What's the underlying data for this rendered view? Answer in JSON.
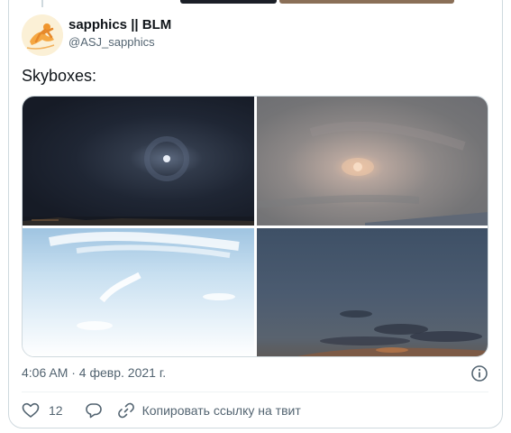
{
  "author": {
    "name": "sapphics || BLM",
    "handle": "@ASJ_sapphics"
  },
  "tweet": {
    "text": "Skyboxes:",
    "timestamp": "4:06 AM · 4 февр. 2021 г."
  },
  "media": [
    {
      "name": "dark-night-sky-moon"
    },
    {
      "name": "overcast-sky-sun"
    },
    {
      "name": "blue-sky-clouds"
    },
    {
      "name": "dusk-sky-clouds"
    }
  ],
  "actions": {
    "like_icon": "heart-icon",
    "like_count": "12",
    "reply_icon": "reply-icon",
    "copy_icon": "link-icon",
    "copy_label": "Копировать ссылку на твит"
  },
  "colors": {
    "border": "#cfd9de",
    "secondary_text": "#536471",
    "primary_text": "#0f1419"
  }
}
